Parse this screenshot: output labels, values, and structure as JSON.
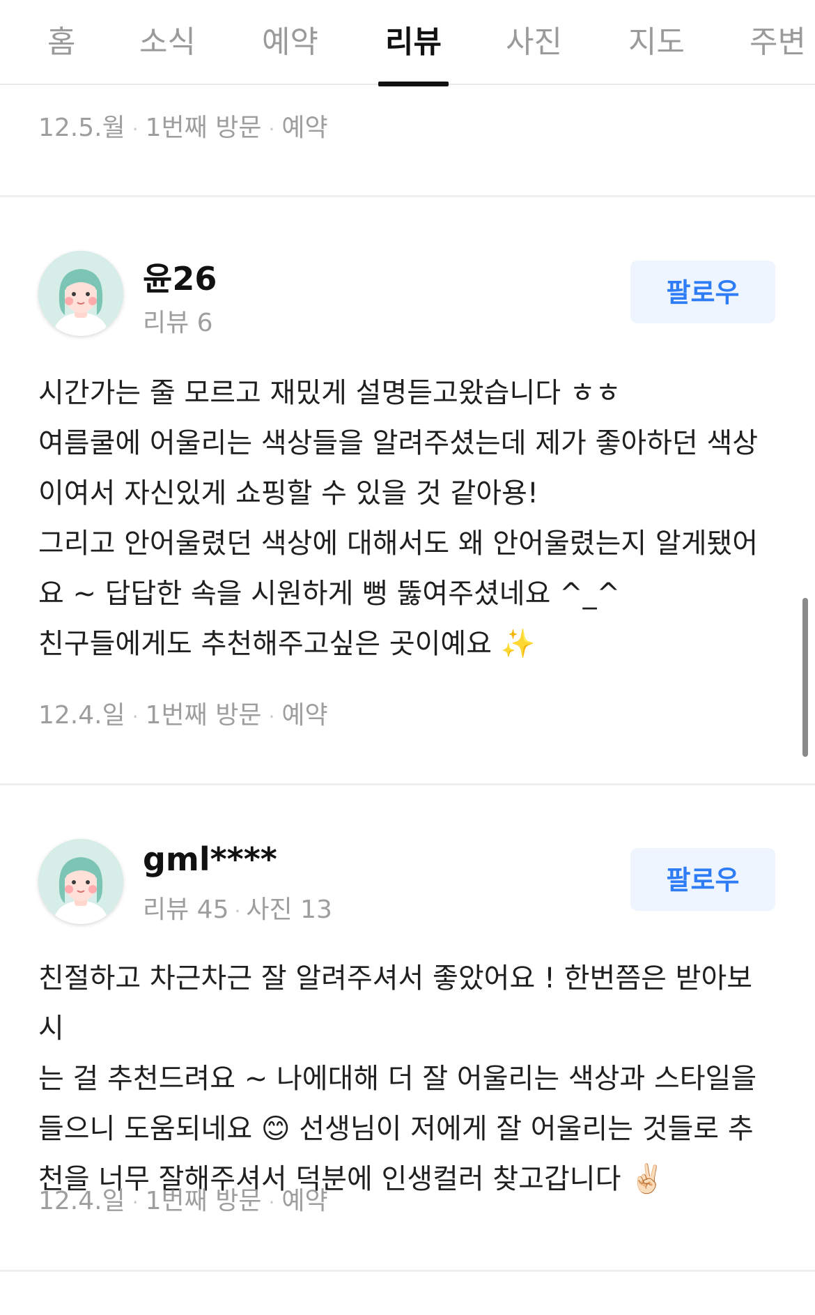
{
  "tabs": [
    {
      "label": "홈"
    },
    {
      "label": "소식"
    },
    {
      "label": "예약"
    },
    {
      "label": "리뷰",
      "active": true
    },
    {
      "label": "사진"
    },
    {
      "label": "지도"
    },
    {
      "label": "주변"
    }
  ],
  "top_meta": {
    "date": "12.5.월",
    "visit": "1번째 방문",
    "type": "예약"
  },
  "reviews": [
    {
      "username": "윤26",
      "stats": "리뷰 6",
      "follow_label": "팔로우",
      "text": [
        "시간가는 줄 모르고 재밌게 설명듣고왔습니다 ㅎㅎ",
        "여름쿨에 어울리는 색상들을 알려주셨는데 제가 좋아하던 색상",
        "이여서 자신있게 쇼핑할 수 있을 것 같아용!",
        "그리고 안어울렸던 색상에 대해서도 왜 안어울렸는지 알게됐어",
        "요 ~ 답답한 속을 시원하게 뻥 뚫여주셨네요 ^_^",
        "친구들에게도 추천해주고싶은 곳이예요 ✨"
      ],
      "meta": {
        "date": "12.4.일",
        "visit": "1번째 방문",
        "type": "예약"
      }
    },
    {
      "username": "gml****",
      "stats": "리뷰 45",
      "stats2": "사진 13",
      "follow_label": "팔로우",
      "text": [
        "친절하고 차근차근 잘 알려주셔서 좋았어요 ! 한번쯤은 받아보시",
        "는 걸 추천드려요 ~ 나에대해 더 잘 어울리는 색상과 스타일을",
        "들으니 도움되네요 😊 선생님이 저에게 잘 어울리는 것들로 추",
        "천을 너무 잘해주셔서 덕분에 인생컬러 찾고갑니다 ✌🏻"
      ],
      "meta": {
        "date": "12.4.일",
        "visit": "1번째 방문",
        "type": "예약"
      }
    }
  ]
}
